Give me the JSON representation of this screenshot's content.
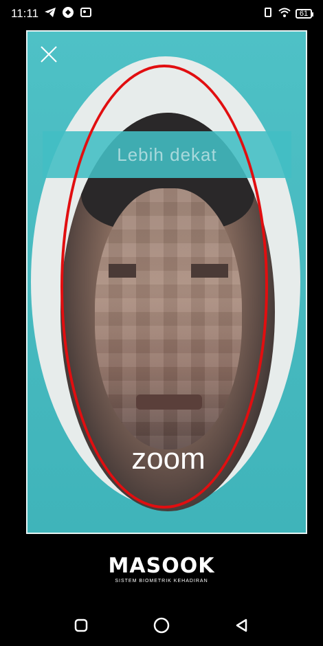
{
  "status_bar": {
    "time": "11:11",
    "battery_level": "61",
    "icons": [
      "telegram-icon",
      "app-icon",
      "photos-icon",
      "vibrate-icon",
      "wifi-icon",
      "battery-icon"
    ]
  },
  "camera": {
    "hint_text": "Lebih dekat",
    "logo_text": "zoom",
    "guide_color": "#e10e10",
    "frame_color": "#4ec1c6"
  },
  "brand": {
    "name": "MASOOK",
    "subtitle": "SISTEM BIOMETRIK KEHADIRAN"
  },
  "nav": {
    "icons": [
      "recent-apps-icon",
      "home-icon",
      "back-icon"
    ]
  }
}
